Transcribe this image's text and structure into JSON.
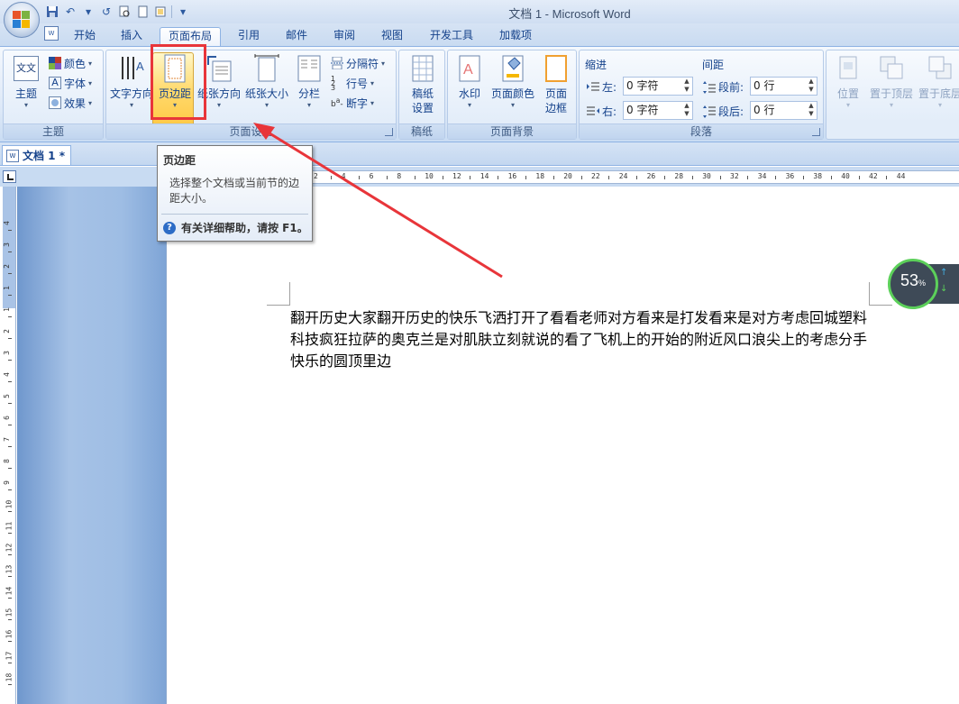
{
  "app": {
    "window_title": "文档 1 - Microsoft Word"
  },
  "tabs": [
    "开始",
    "插入",
    "页面布局",
    "引用",
    "邮件",
    "审阅",
    "视图",
    "开发工具",
    "加载项"
  ],
  "ribbon": {
    "theme_group": {
      "label": "主题",
      "theme_button": "主题",
      "colors": "颜色",
      "fonts": "字体",
      "effects": "效果",
      "theme_icon_text": "文文"
    },
    "page_setup_group": {
      "label": "页面设置",
      "text_direction": "文字方向",
      "margins": "页边距",
      "orientation": "纸张方向",
      "size": "纸张大小",
      "columns": "分栏",
      "breaks": "分隔符",
      "line_numbers": "行号",
      "hyphenation": "断字"
    },
    "draft_group": {
      "label": "稿纸",
      "draft_setup_line1": "稿纸",
      "draft_setup_line2": "设置"
    },
    "page_background_group": {
      "label": "页面背景",
      "watermark": "水印",
      "page_color": "页面颜色",
      "page_borders_line1": "页面",
      "page_borders_line2": "边框"
    },
    "paragraph_group": {
      "label": "段落",
      "indent_title": "缩进",
      "spacing_title": "间距",
      "indent_left_label": "左:",
      "indent_left_value": "0 字符",
      "indent_right_label": "右:",
      "indent_right_value": "0 字符",
      "spacing_before_label": "段前:",
      "spacing_before_value": "0 行",
      "spacing_after_label": "段后:",
      "spacing_after_value": "0 行"
    },
    "arrange_group": {
      "position": "位置",
      "bring_to_front": "置于顶层",
      "send_to_back": "置于底层"
    }
  },
  "doc_tab": {
    "label": "文档 1 *"
  },
  "tooltip": {
    "title": "页边距",
    "body": "选择整个文档或当前节的边距大小。",
    "help": "有关详细帮助，请按 F1。"
  },
  "document": {
    "text": "翻开历史大家翻开历史的快乐飞洒打开了看看老师对方看来是打发看来是对方考虑回城塑料科技疯狂拉萨的奥克兰是对肌肤立刻就说的看了飞机上的开始的附近风口浪尖上的考虑分手快乐的圆顶里边"
  },
  "ruler": {
    "h_numbers": [
      "2",
      "4",
      "6",
      "8",
      "10",
      "12",
      "14",
      "16",
      "18",
      "20",
      "22",
      "24",
      "26",
      "28",
      "30",
      "32",
      "34",
      "36",
      "38",
      "40",
      "42",
      "44"
    ],
    "v_numbers": [
      "4",
      "3",
      "2",
      "1",
      "1",
      "2",
      "3",
      "4",
      "5",
      "6",
      "7",
      "8",
      "9",
      "10",
      "11",
      "12",
      "13",
      "14",
      "15",
      "16",
      "17",
      "18"
    ]
  },
  "widget": {
    "percent": "53",
    "unit": "%"
  },
  "colors": {
    "accent": "#15428b",
    "highlight": "#ffc33a",
    "annotation": "#e8353a"
  }
}
